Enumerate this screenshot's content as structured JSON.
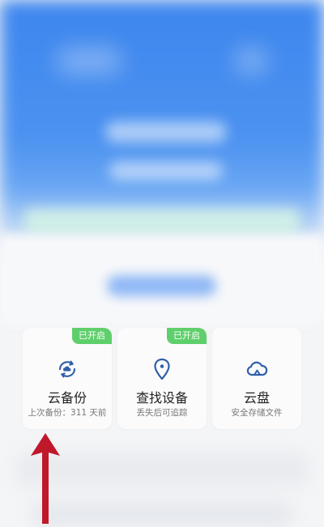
{
  "cards": [
    {
      "title": "云备份",
      "subtitle": "上次备份：311 天前",
      "badge": "已开启",
      "icon": "cloud-sync-icon"
    },
    {
      "title": "查找设备",
      "subtitle": "丢失后可追踪",
      "badge": "已开启",
      "icon": "location-pin-icon"
    },
    {
      "title": "云盘",
      "subtitle": "安全存储文件",
      "badge": "",
      "icon": "cloud-icon"
    }
  ],
  "colors": {
    "badge": "#5fcf6c",
    "icon_blue": "#2f5fa8",
    "arrow_red": "#c0182b",
    "hero_blue": "#4c92f0"
  },
  "annotation": {
    "icon": "red-arrow-icon"
  }
}
